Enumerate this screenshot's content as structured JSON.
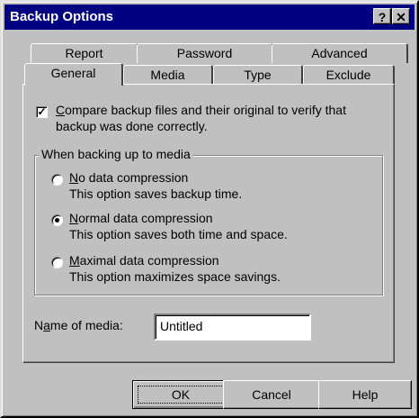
{
  "window": {
    "title": "Backup Options",
    "help_label": "?",
    "close_label": "x"
  },
  "tabs": {
    "row1": [
      "Report",
      "Password",
      "Advanced"
    ],
    "row2": [
      "General",
      "Media",
      "Type",
      "Exclude"
    ],
    "active": "General"
  },
  "compare": {
    "checked": true,
    "line1": "Compare backup files and their original to verify that",
    "line2": "backup was done correctly."
  },
  "group": {
    "title": "When backing up to media",
    "options": [
      {
        "label": "No data compression",
        "desc": "This option saves backup time.",
        "selected": false
      },
      {
        "label": "Normal data compression",
        "desc": "This option saves both time and space.",
        "selected": true
      },
      {
        "label": "Maximal data compression",
        "desc": "This option maximizes space savings.",
        "selected": false
      }
    ]
  },
  "media_name": {
    "label": "Name of media:",
    "value": "Untitled"
  },
  "buttons": {
    "ok": "OK",
    "cancel": "Cancel",
    "help": "Help"
  }
}
